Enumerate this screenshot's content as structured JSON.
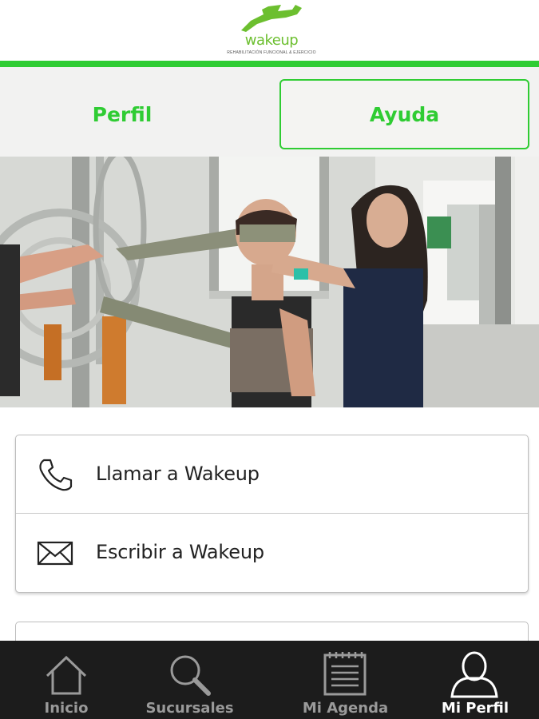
{
  "header": {
    "logo_text": "wakeup",
    "logo_tagline": "REHABILITACIÓN FUNCIONAL & EJERCICIO",
    "brand_color": "#2fcc33"
  },
  "tabs": [
    {
      "label": "Perfil",
      "active": false
    },
    {
      "label": "Ayuda",
      "active": true
    }
  ],
  "hero_image": {
    "icon": "physiotherapy-photo"
  },
  "contact": {
    "call_label": "Llamar a Wakeup",
    "call_icon": "phone-icon",
    "mail_label": "Escribir a Wakeup",
    "mail_icon": "envelope-icon"
  },
  "bottom_nav": [
    {
      "label": "Inicio",
      "icon": "home-icon",
      "active": false
    },
    {
      "label": "Sucursales",
      "icon": "search-icon",
      "active": false
    },
    {
      "label": "Mi Agenda",
      "icon": "notepad-icon",
      "active": false
    },
    {
      "label": "Mi Perfil",
      "icon": "user-icon",
      "active": true
    }
  ]
}
